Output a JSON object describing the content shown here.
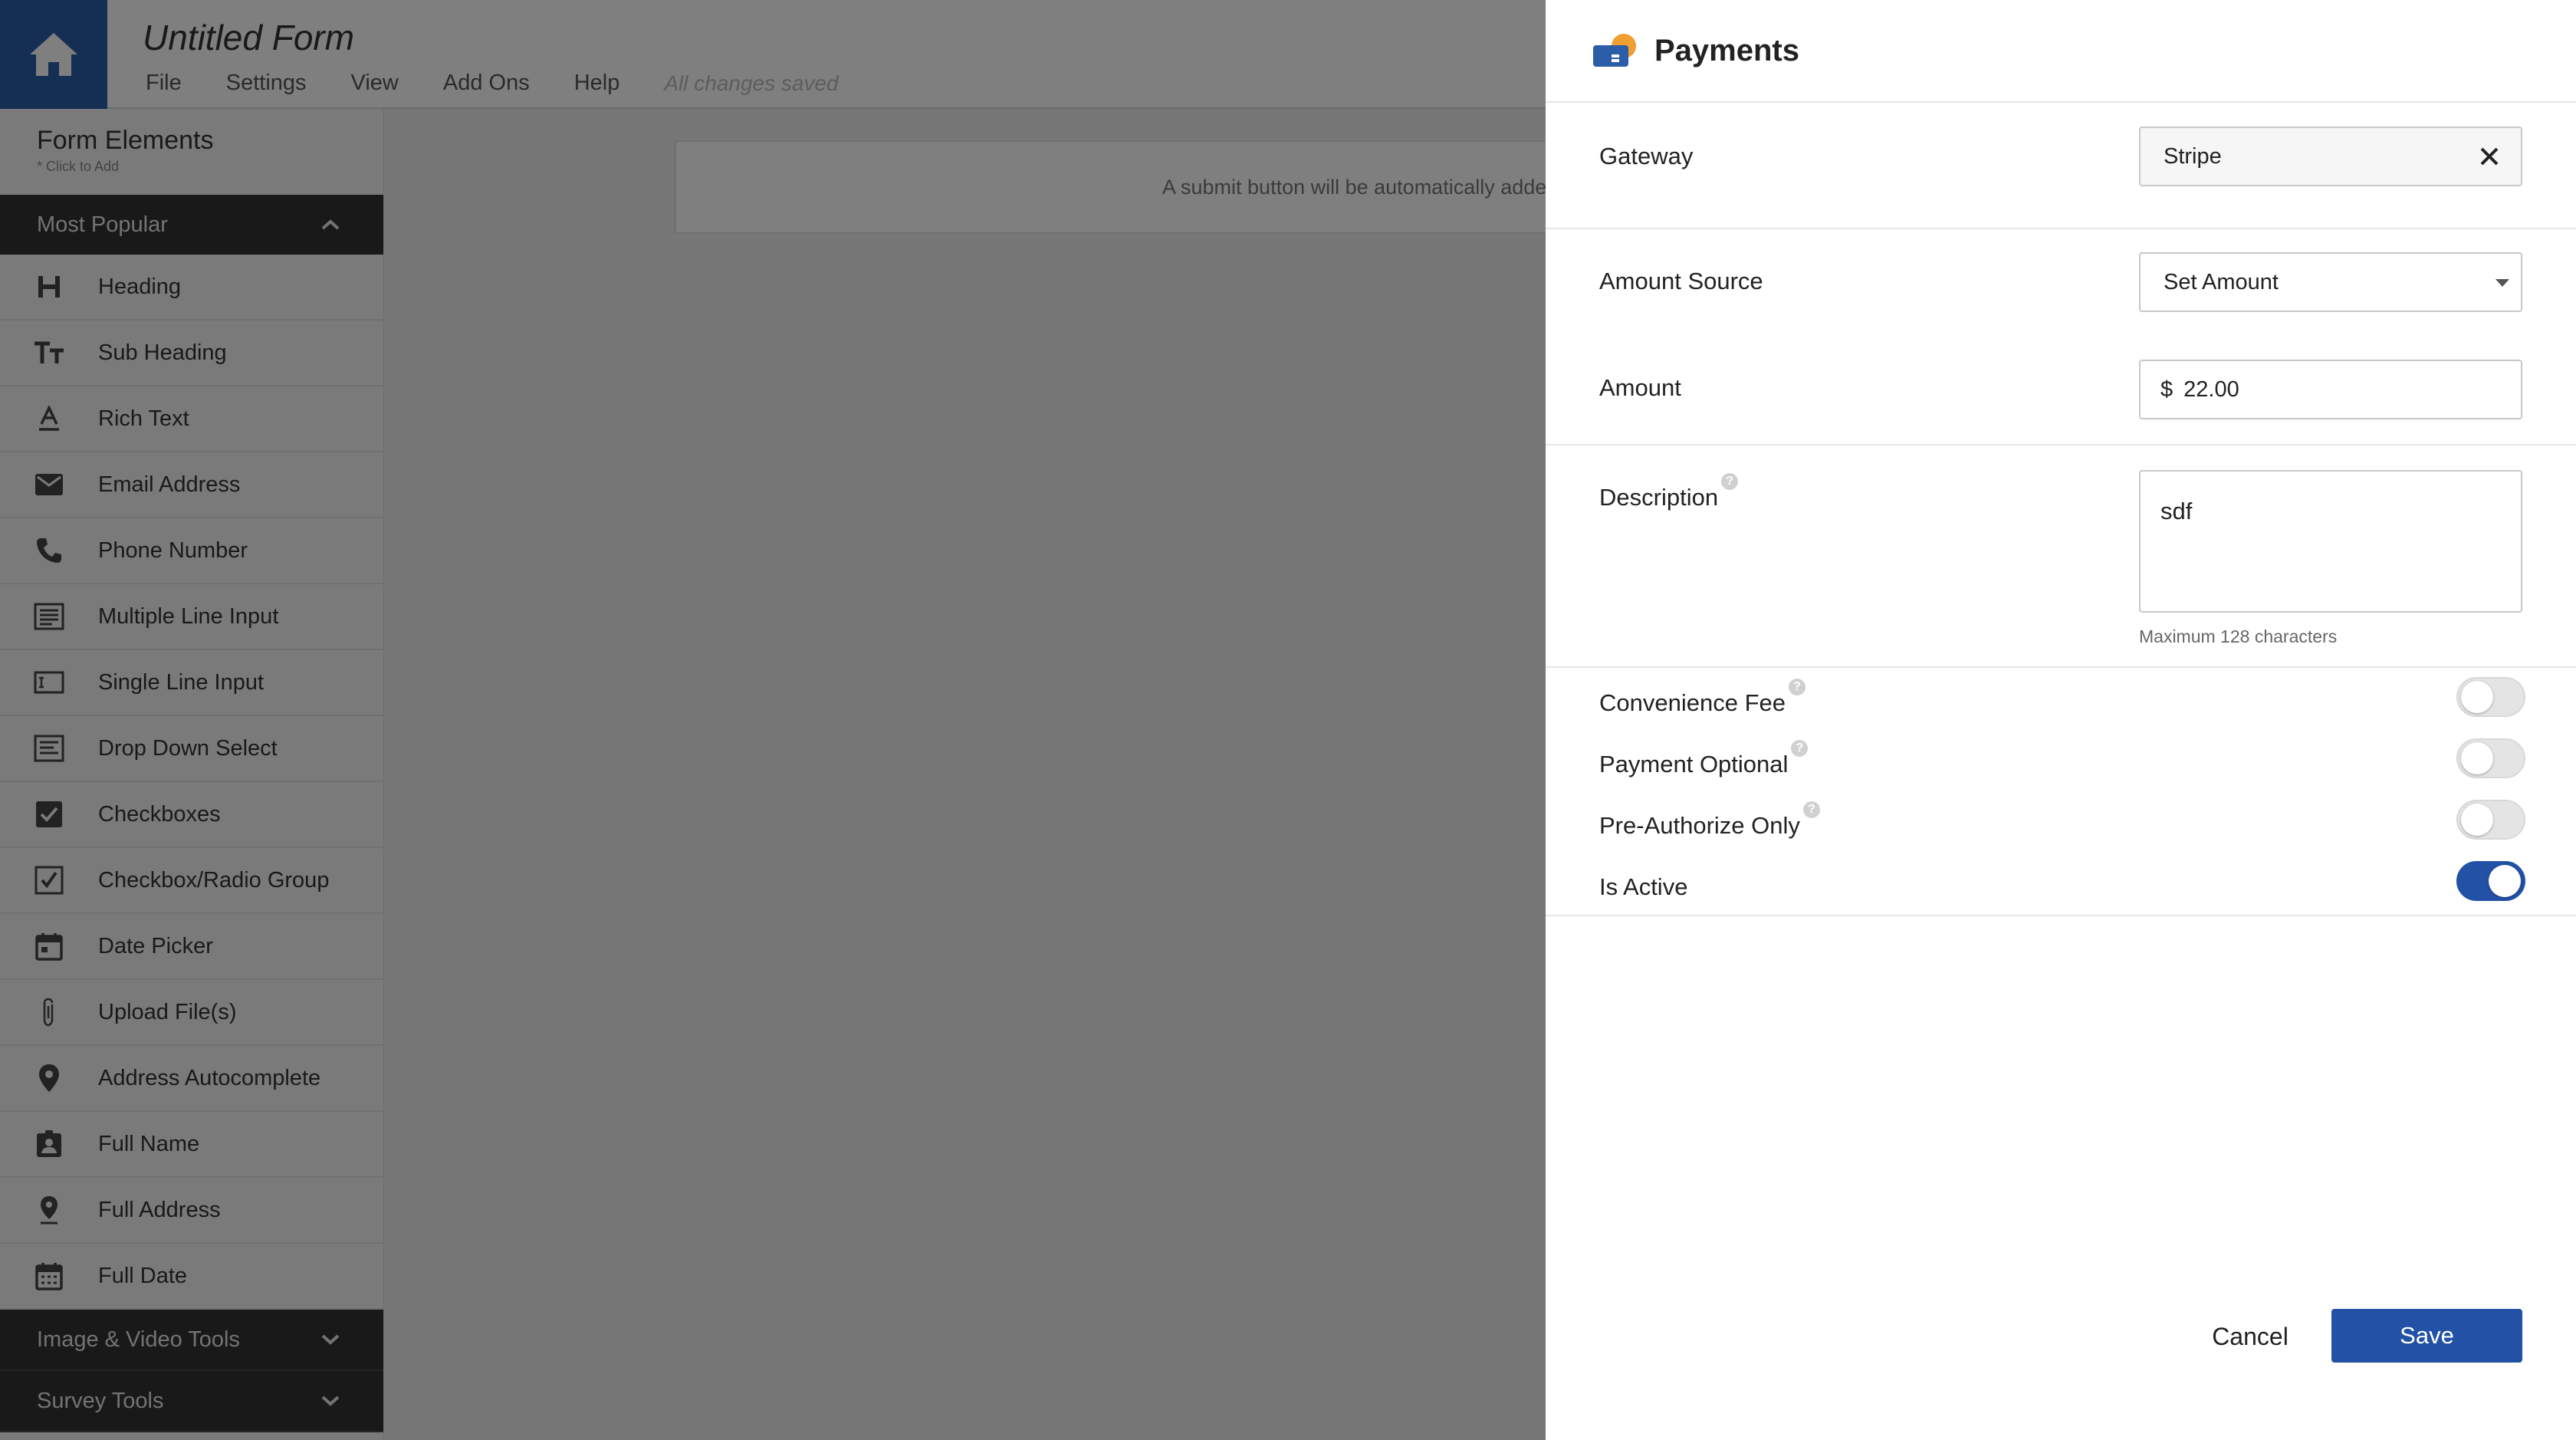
{
  "app": {
    "form_title": "Untitled Form",
    "menu": [
      "File",
      "Settings",
      "View",
      "Add Ons",
      "Help"
    ],
    "save_status": "All changes saved"
  },
  "sidebar": {
    "title": "Form Elements",
    "subtitle": "* Click to Add",
    "group_open": "Most Popular",
    "items": [
      {
        "label": "Heading",
        "icon": "heading-icon"
      },
      {
        "label": "Sub Heading",
        "icon": "subheading-icon"
      },
      {
        "label": "Rich Text",
        "icon": "rich-text-icon"
      },
      {
        "label": "Email Address",
        "icon": "email-icon"
      },
      {
        "label": "Phone Number",
        "icon": "phone-icon"
      },
      {
        "label": "Multiple Line Input",
        "icon": "multiline-icon"
      },
      {
        "label": "Single Line Input",
        "icon": "single-line-icon"
      },
      {
        "label": "Drop Down Select",
        "icon": "dropdown-icon"
      },
      {
        "label": "Checkboxes",
        "icon": "checkbox-icon"
      },
      {
        "label": "Checkbox/Radio Group",
        "icon": "checkbox-group-icon"
      },
      {
        "label": "Date Picker",
        "icon": "calendar-icon"
      },
      {
        "label": "Upload File(s)",
        "icon": "paperclip-icon"
      },
      {
        "label": "Address Autocomplete",
        "icon": "location-pin-icon"
      },
      {
        "label": "Full Name",
        "icon": "contact-badge-icon"
      },
      {
        "label": "Full Address",
        "icon": "address-pin-icon"
      },
      {
        "label": "Full Date",
        "icon": "full-date-icon"
      }
    ],
    "groups_collapsed": [
      "Image & Video Tools",
      "Survey Tools"
    ]
  },
  "canvas": {
    "note": "A submit button will be automatically added"
  },
  "panel": {
    "title": "Payments",
    "gateway": {
      "label": "Gateway",
      "value": "Stripe"
    },
    "amount_source": {
      "label": "Amount Source",
      "value": "Set Amount"
    },
    "amount": {
      "label": "Amount",
      "currency": "$",
      "value": "22.00"
    },
    "description": {
      "label": "Description",
      "value": "sdf",
      "hint": "Maximum 128 characters"
    },
    "toggles": [
      {
        "label": "Convenience Fee",
        "on": false,
        "help": true
      },
      {
        "label": "Payment Optional",
        "on": false,
        "help": true
      },
      {
        "label": "Pre-Authorize Only",
        "on": false,
        "help": true
      },
      {
        "label": "Is Active",
        "on": true,
        "help": false
      }
    ],
    "cancel_label": "Cancel",
    "save_label": "Save"
  },
  "colors": {
    "brand_blue": "#2251a5",
    "home_blue": "#2b5da8",
    "payments_icon_orange": "#f0a030"
  }
}
